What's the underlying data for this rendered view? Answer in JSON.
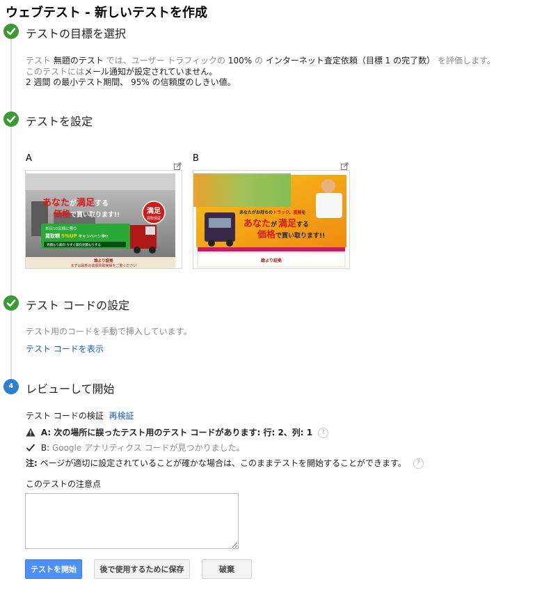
{
  "page": {
    "title": "ウェブテスト - 新しいテストを作成"
  },
  "steps": {
    "objective": {
      "heading": "テストの目標を選択",
      "line1": {
        "a": "テスト",
        "b": "無題のテスト",
        "c": "では、ユーザー トラフィックの",
        "d": "100%",
        "e": "の",
        "f": "インターネット査定依頼（目標 1 の完了数）",
        "g": "を評価します。"
      },
      "line2": {
        "a": "このテストには",
        "b": "メール通知が設定されていません。"
      },
      "line3": {
        "a": "2 週間",
        "b": "の最小テスト期間、",
        "c": "95%",
        "d": "の信頼度のしきい値。"
      }
    },
    "configure": {
      "heading": "テストを設定",
      "variantA": {
        "label": "A",
        "headline_pre": "あなた",
        "headline_mid": "が",
        "headline_accent": "満足",
        "headline_post": "する",
        "headline2_a": "価格",
        "headline2_b": "で買い取ります!!",
        "badge": "満足",
        "badge_sub": "買取保証",
        "campaign_l1": "本日10名様に限り",
        "campaign_l2a": "買取額",
        "campaign_l2b": "5%UP",
        "campaign_l2c": "キャンペーン中!!",
        "campaign_l3": "見積もり無料  今すぐ無料見積もりする",
        "footer1": "論より証拠",
        "footer2": "まずは最新の高額買取実績をご覧ください"
      },
      "variantB": {
        "label": "B",
        "tagline_a": "あなたがお持ちの",
        "tagline_b": "トラック",
        "tagline_c": "、",
        "tagline_d": "重機",
        "tagline_e": "を",
        "headline_pre": "あなた",
        "headline_mid": "が",
        "headline_accent": "満足",
        "headline_post": "する",
        "headline2_a": "価格",
        "headline2_b": "で買い取ります!!",
        "footer1": "論より証拠"
      }
    },
    "code": {
      "heading": "テスト コードの設定",
      "manual_text": "テスト用のコードを手動で挿入しています。",
      "show_link": "テスト コードを表示"
    },
    "review": {
      "number": "4",
      "heading": "レビューして開始",
      "verify_label": "テスト コードの検証",
      "reverify_link": "再検証",
      "warning_bold": "A: 次の場所に誤ったテスト用のテスト コードがあります: 行: 2、列: 1",
      "ok_prefix": "B:",
      "ok_text": "Google アナリティクス コードが見つかりました。",
      "note_label": "注:",
      "note_text": "ページが適切に設定されていることが確かな場合は、このままテストを開始することができます。",
      "notes_label": "このテストの注意点",
      "notes_value": ""
    }
  },
  "buttons": {
    "start": "テストを開始",
    "save": "後で使用するために保存",
    "discard": "破棄"
  },
  "help_glyph": "?",
  "colors": {
    "step_done": "#3b9b32",
    "step_current": "#2f7fd1",
    "link": "#1a5fb0",
    "primary_button": "#4d90fe"
  }
}
